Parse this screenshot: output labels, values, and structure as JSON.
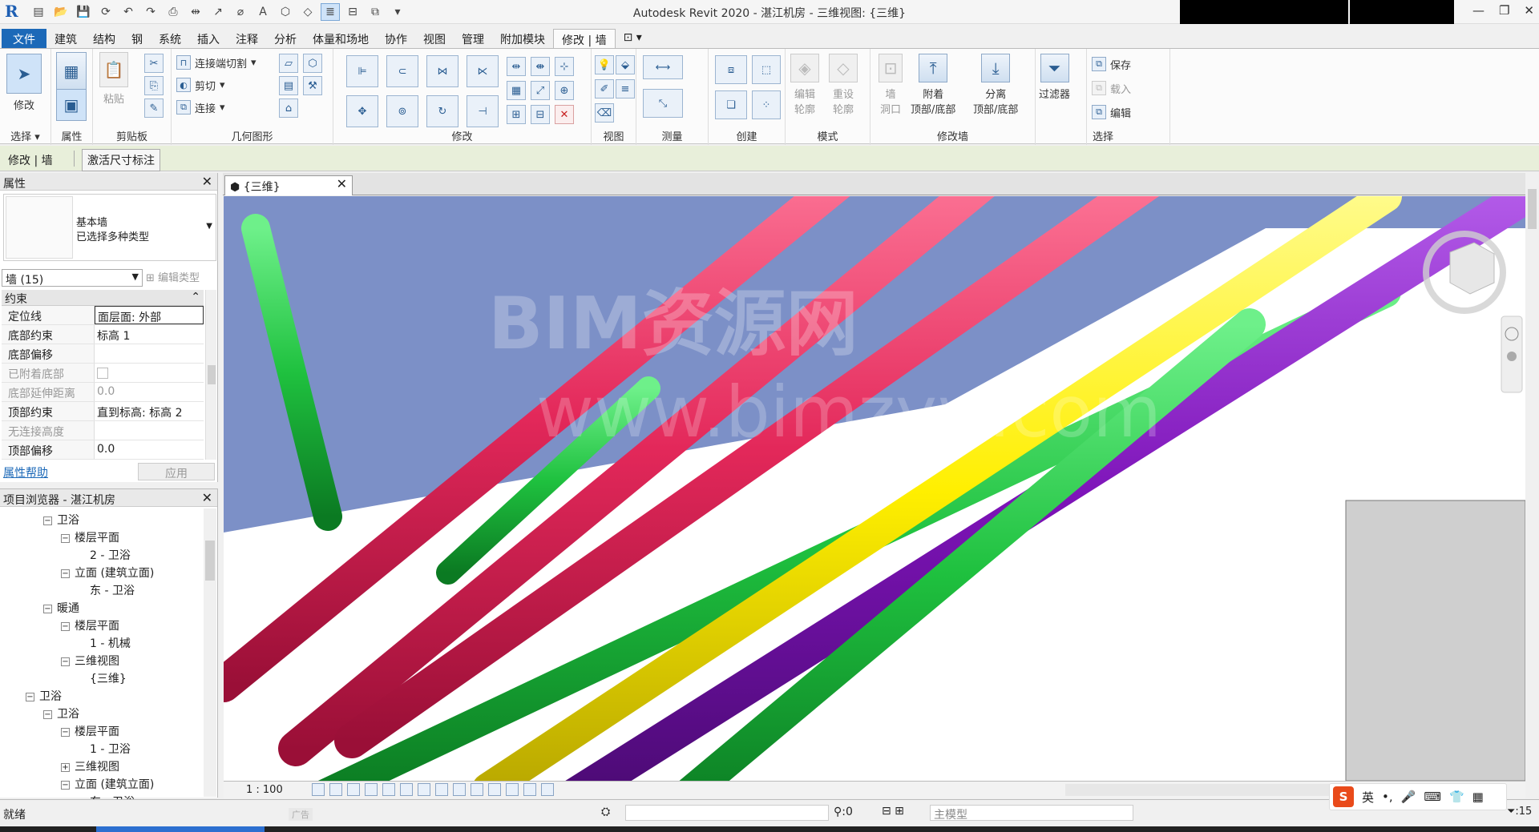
{
  "window": {
    "title": "Autodesk Revit 2020 - 湛江机房 - 三维视图: {三维}"
  },
  "ribbon_tabs": [
    "文件",
    "建筑",
    "结构",
    "钢",
    "系统",
    "插入",
    "注释",
    "分析",
    "体量和场地",
    "协作",
    "视图",
    "管理",
    "附加模块",
    "修改 | 墙"
  ],
  "ribbon": {
    "modify_label": "修改",
    "select_label": "选择",
    "properties_label": "属性",
    "paste_label": "粘贴",
    "clipboard_label": "剪贴板",
    "cope_label": "连接端切割",
    "cut_label": "剪切",
    "join_label": "连接",
    "geometry_label": "几何图形",
    "modify_panel_label": "修改",
    "view_label": "视图",
    "measure_label": "测量",
    "create_label": "创建",
    "edit_profile": "编辑\n轮廓",
    "reset_profile": "重设\n轮廓",
    "wall_opening": "墙\n洞口",
    "mode_label": "模式",
    "attach_label": "附着",
    "attach_sub": "顶部/底部",
    "detach_label": "分离",
    "detach_sub": "顶部/底部",
    "modify_wall_label": "修改墙",
    "filter_label": "过滤器",
    "save_label": "保存",
    "load_label": "载入",
    "edit_label": "编辑",
    "selection_label": "选择"
  },
  "options_bar": {
    "context": "修改 | 墙",
    "activate_dims": "激活尺寸标注"
  },
  "properties": {
    "title": "属性",
    "type_family": "基本墙",
    "type_name": "已选择多种类型",
    "instance_filter": "墙 (15)",
    "edit_type": "编辑类型",
    "section": "约束",
    "rows": [
      {
        "key": "定位线",
        "value": "面层面: 外部"
      },
      {
        "key": "底部约束",
        "value": "标高 1"
      },
      {
        "key": "底部偏移",
        "value": ""
      },
      {
        "key": "已附着底部",
        "value": ""
      },
      {
        "key": "底部延伸距离",
        "value": "0.0"
      },
      {
        "key": "顶部约束",
        "value": "直到标高: 标高 2"
      },
      {
        "key": "无连接高度",
        "value": ""
      },
      {
        "key": "顶部偏移",
        "value": "0.0"
      }
    ],
    "help": "属性帮助",
    "apply": "应用"
  },
  "browser": {
    "title": "项目浏览器 - 湛江机房",
    "nodes": [
      {
        "label": "卫浴",
        "box": "−"
      },
      {
        "label": "楼层平面",
        "box": "−"
      },
      {
        "label": "2 - 卫浴",
        "box": ""
      },
      {
        "label": "立面 (建筑立面)",
        "box": "−"
      },
      {
        "label": "东 - 卫浴",
        "box": ""
      },
      {
        "label": "暖通",
        "box": "−"
      },
      {
        "label": "楼层平面",
        "box": "−"
      },
      {
        "label": "1 - 机械",
        "box": ""
      },
      {
        "label": "三维视图",
        "box": "−"
      },
      {
        "label": "{三维}",
        "box": ""
      },
      {
        "label": "卫浴",
        "box": "−"
      },
      {
        "label": "卫浴",
        "box": "−"
      },
      {
        "label": "楼层平面",
        "box": "−"
      },
      {
        "label": "1 - 卫浴",
        "box": ""
      },
      {
        "label": "三维视图",
        "box": "+"
      },
      {
        "label": "立面 (建筑立面)",
        "box": "−"
      },
      {
        "label": "东 - 卫浴",
        "box": ""
      }
    ]
  },
  "view": {
    "tab_label": "{三维}",
    "scale": "1 : 100",
    "watermark1": "BIM资源网",
    "watermark2": "www.bimzyw.com"
  },
  "status": {
    "ready": "就绪",
    "ad": "广告",
    "worksets": "",
    "count": ":0",
    "model": "主模型",
    "filter": ":15"
  },
  "ime": {
    "logo": "S",
    "lang": "英",
    "punct": "•,"
  },
  "colors": {
    "file_tab": "#1c69b8",
    "pipe_green": "#1fc13f",
    "pipe_red": "#e3285a",
    "pipe_yellow": "#ffef00",
    "pipe_purple": "#7d13b8",
    "sky": "#7c90c7"
  }
}
